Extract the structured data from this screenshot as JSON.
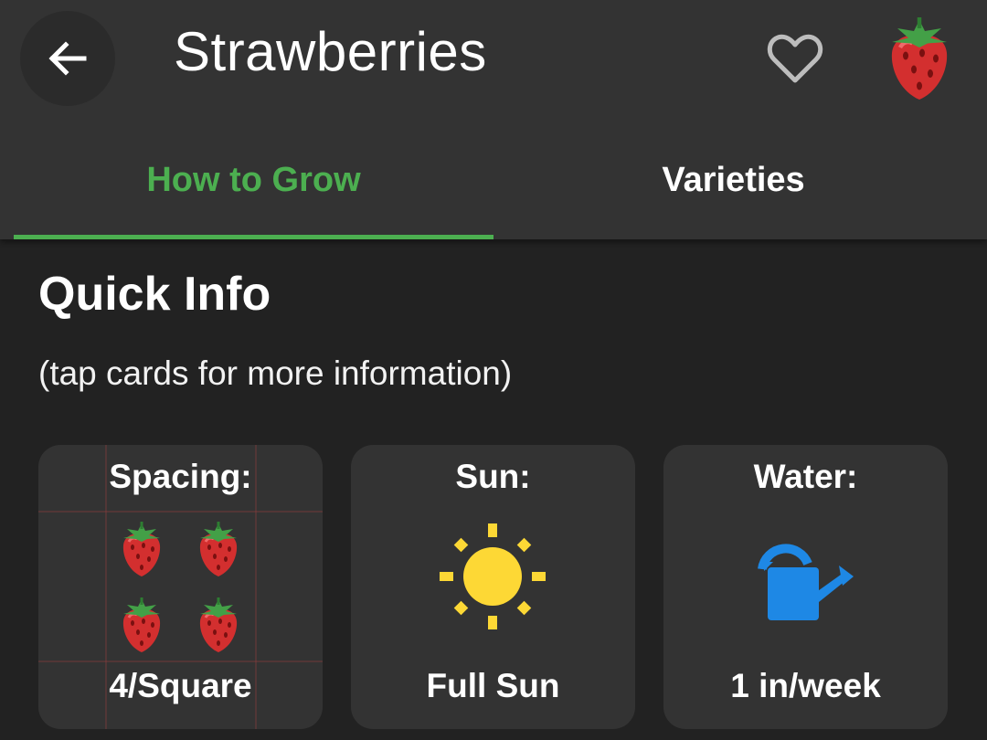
{
  "header": {
    "title": "Strawberries",
    "back_icon": "arrow-left-icon",
    "favorite_icon": "heart-outline-icon",
    "plant_icon": "strawberry-icon"
  },
  "tabs": [
    {
      "label": "How to Grow",
      "active": true
    },
    {
      "label": "Varieties",
      "active": false
    }
  ],
  "quick_info": {
    "title": "Quick Info",
    "hint": "(tap cards for more information)",
    "cards": [
      {
        "label": "Spacing:",
        "value": "4/Square",
        "icon": "strawberry-grid-icon"
      },
      {
        "label": "Sun:",
        "value": "Full Sun",
        "icon": "sun-icon"
      },
      {
        "label": "Water:",
        "value": "1 in/week",
        "icon": "watering-can-icon"
      }
    ]
  },
  "colors": {
    "accent": "#4caf50",
    "appbar": "#333333",
    "background": "#222222",
    "sun": "#fdd835",
    "water": "#1e88e5",
    "berry": "#d32f2f"
  }
}
